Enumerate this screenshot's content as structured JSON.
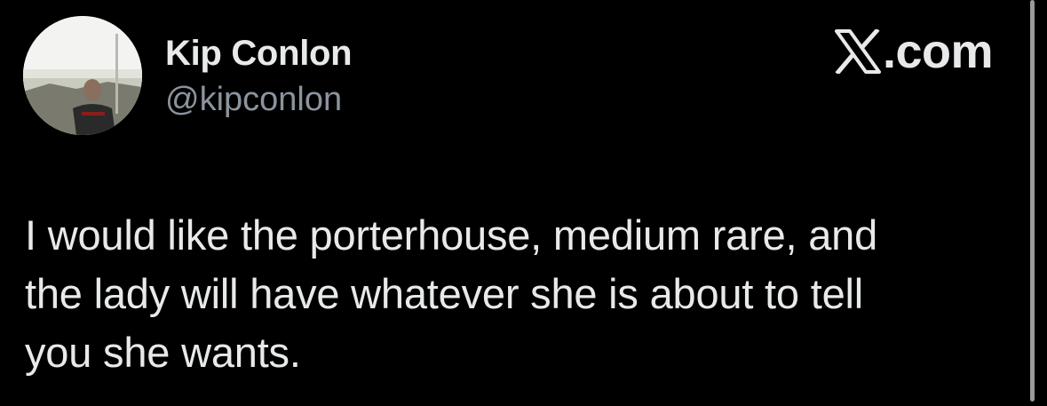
{
  "author": {
    "display_name": "Kip Conlon",
    "handle": "@kipconlon"
  },
  "site": {
    "logo_icon": "x-logo-icon",
    "suffix": ".com"
  },
  "tweet": {
    "lines": [
      "I would like the porterhouse, medium rare, and",
      "the lady will have whatever she is about to tell",
      "you she wants."
    ]
  },
  "colors": {
    "background": "#000000",
    "primary_text": "#e7e9ea",
    "secondary_text": "#8b949e"
  }
}
